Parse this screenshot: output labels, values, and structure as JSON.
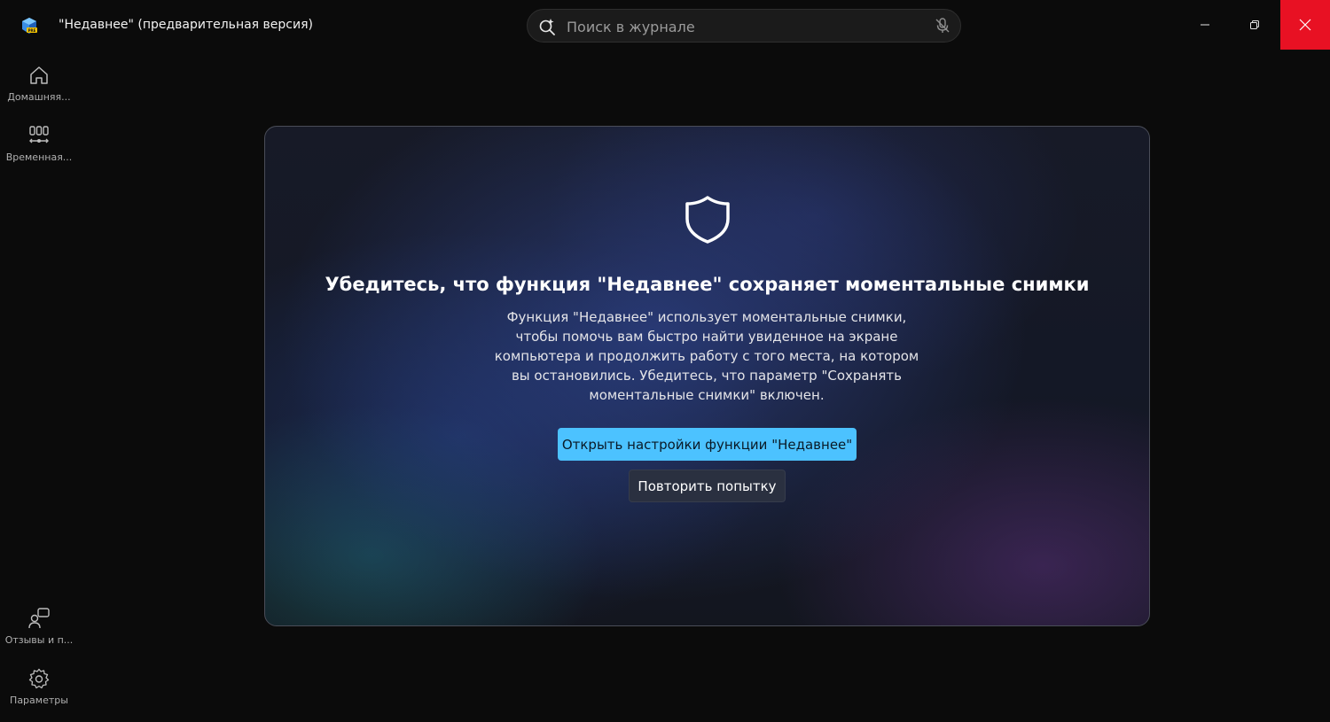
{
  "window": {
    "title": "\"Недавнее\" (предварительная версия)",
    "app_icon": "recall-app-icon",
    "controls": {
      "minimize_icon": "minimize-icon",
      "maximize_icon": "restore-icon",
      "close_icon": "close-icon",
      "close_color": "#e81123"
    }
  },
  "search": {
    "placeholder": "Поиск в журнале",
    "value": "",
    "icon": "search-sparkle-icon",
    "mic_icon": "microphone-off-icon"
  },
  "sidebar": {
    "top_items": [
      {
        "label": "Домашняя...",
        "icon": "home-icon"
      },
      {
        "label": "Временная...",
        "icon": "timeline-icon"
      }
    ],
    "bottom_items": [
      {
        "label": "Отзывы и п...",
        "icon": "feedback-icon"
      },
      {
        "label": "Параметры",
        "icon": "settings-icon"
      }
    ]
  },
  "main": {
    "icon": "shield-icon",
    "title": "Убедитесь, что функция \"Недавнее\" сохраняет моментальные снимки",
    "body_lines": [
      "Функция \"Недавнее\" использует моментальные снимки,",
      "чтобы помочь вам быстро найти увиденное на экране",
      "компьютера и продолжить работу с того места, на котором",
      "вы остановились. Убедитесь, что параметр \"Сохранять",
      "моментальные снимки\" включен."
    ],
    "primary_button": "Открыть настройки функции \"Недавнее\"",
    "secondary_button": "Повторить попытку"
  },
  "colors": {
    "accent": "#4cc2ff",
    "background": "#0b0b0b"
  }
}
